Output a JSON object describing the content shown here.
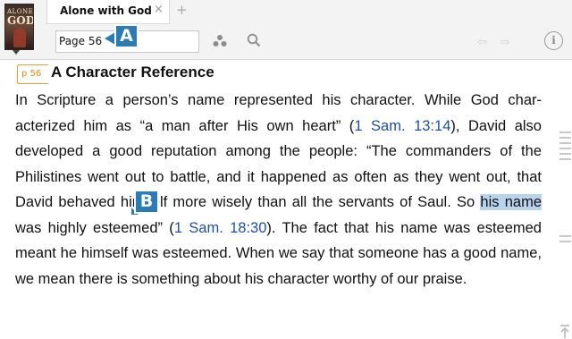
{
  "book_cover": {
    "line1": "ALONE",
    "line2": "GOD"
  },
  "tab": {
    "title": "Alone with God",
    "close_glyph": "×",
    "add_glyph": "+"
  },
  "toolbar": {
    "page_input_value": "Page 56",
    "badge_a": "A",
    "people_icon": "people-icon",
    "search_icon": "search-icon",
    "back_glyph": "⇦",
    "forward_glyph": "⇨",
    "info_glyph": "i"
  },
  "reader": {
    "page_marker": "p 56",
    "heading": "A Character Reference",
    "badge_b": "B",
    "paragraph": {
      "p1": "In Scripture a person’s name represented his character. While God char­acterized him as “a man after His own heart” (",
      "ref1": "1 Sam. 13:14",
      "p2": "), David also developed a good reputation among the people: “The commanders of the Philistines went out to battle, and it happened as often as they went out, that David behaved himself more wisely than all the servants of Saul. So ",
      "selection": "his name",
      "p3": " was highly esteemed” (",
      "ref2": "1 Sam. 18:30",
      "p4": "). The fact that his name was esteemed meant he himself was esteemed. When we say that someone has a good name, we mean there is something about his char­acter worthy of our praise."
    }
  },
  "colors": {
    "accent_badge": "#2c7bb4",
    "page_marker": "#e08a12",
    "verse_link": "#1f4f9a",
    "selection": "#b9d3ec"
  }
}
